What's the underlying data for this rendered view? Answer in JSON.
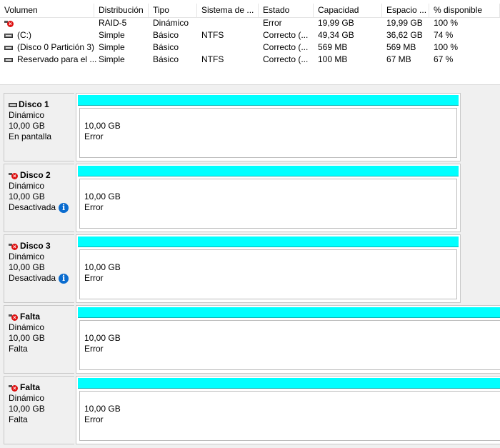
{
  "columns": [
    "Volumen",
    "Distribución",
    "Tipo",
    "Sistema de ...",
    "Estado",
    "Capacidad",
    "Espacio ...",
    "% disponible"
  ],
  "volumes": [
    {
      "icon": "error-drive-icon",
      "name": "",
      "dist": "RAID-5",
      "tipo": "Dinámico",
      "fs": "",
      "estado": "Error",
      "cap": "19,99 GB",
      "esp": "19,99 GB",
      "pct": "100 %"
    },
    {
      "icon": "drive-icon",
      "name": "(C:)",
      "dist": "Simple",
      "tipo": "Básico",
      "fs": "NTFS",
      "estado": "Correcto (...",
      "cap": "49,34 GB",
      "esp": "36,62 GB",
      "pct": "74 %"
    },
    {
      "icon": "drive-icon",
      "name": "(Disco 0 Partición 3)",
      "dist": "Simple",
      "tipo": "Básico",
      "fs": "",
      "estado": "Correcto (...",
      "cap": "569 MB",
      "esp": "569 MB",
      "pct": "100 %"
    },
    {
      "icon": "drive-icon",
      "name": "Reservado para el ...",
      "dist": "Simple",
      "tipo": "Básico",
      "fs": "NTFS",
      "estado": "Correcto (...",
      "cap": "100 MB",
      "esp": "67 MB",
      "pct": "67 %"
    }
  ],
  "disks": [
    {
      "icon": "drive-icon",
      "title": "Disco 1",
      "type": "Dinámico",
      "size": "10,00 GB",
      "status": "En pantalla",
      "info": false,
      "part_size": "10,00 GB",
      "part_status": "Error"
    },
    {
      "icon": "error-drive-icon",
      "title": "Disco 2",
      "type": "Dinámico",
      "size": "10,00 GB",
      "status": "Desactivada",
      "info": true,
      "part_size": "10,00 GB",
      "part_status": "Error"
    },
    {
      "icon": "error-drive-icon",
      "title": "Disco 3",
      "type": "Dinámico",
      "size": "10,00 GB",
      "status": "Desactivada",
      "info": true,
      "part_size": "10,00 GB",
      "part_status": "Error"
    },
    {
      "icon": "error-drive-icon",
      "title": "Falta",
      "type": "Dinámico",
      "size": "10,00 GB",
      "status": "Falta",
      "info": false,
      "part_size": "10,00 GB",
      "part_status": "Error"
    },
    {
      "icon": "error-drive-icon",
      "title": "Falta",
      "type": "Dinámico",
      "size": "10,00 GB",
      "status": "Falta",
      "info": false,
      "part_size": "10,00 GB",
      "part_status": "Error"
    }
  ],
  "colors": {
    "partition_band": "#00ffff",
    "info": "#0a6ccf",
    "error": "#dd1111"
  }
}
